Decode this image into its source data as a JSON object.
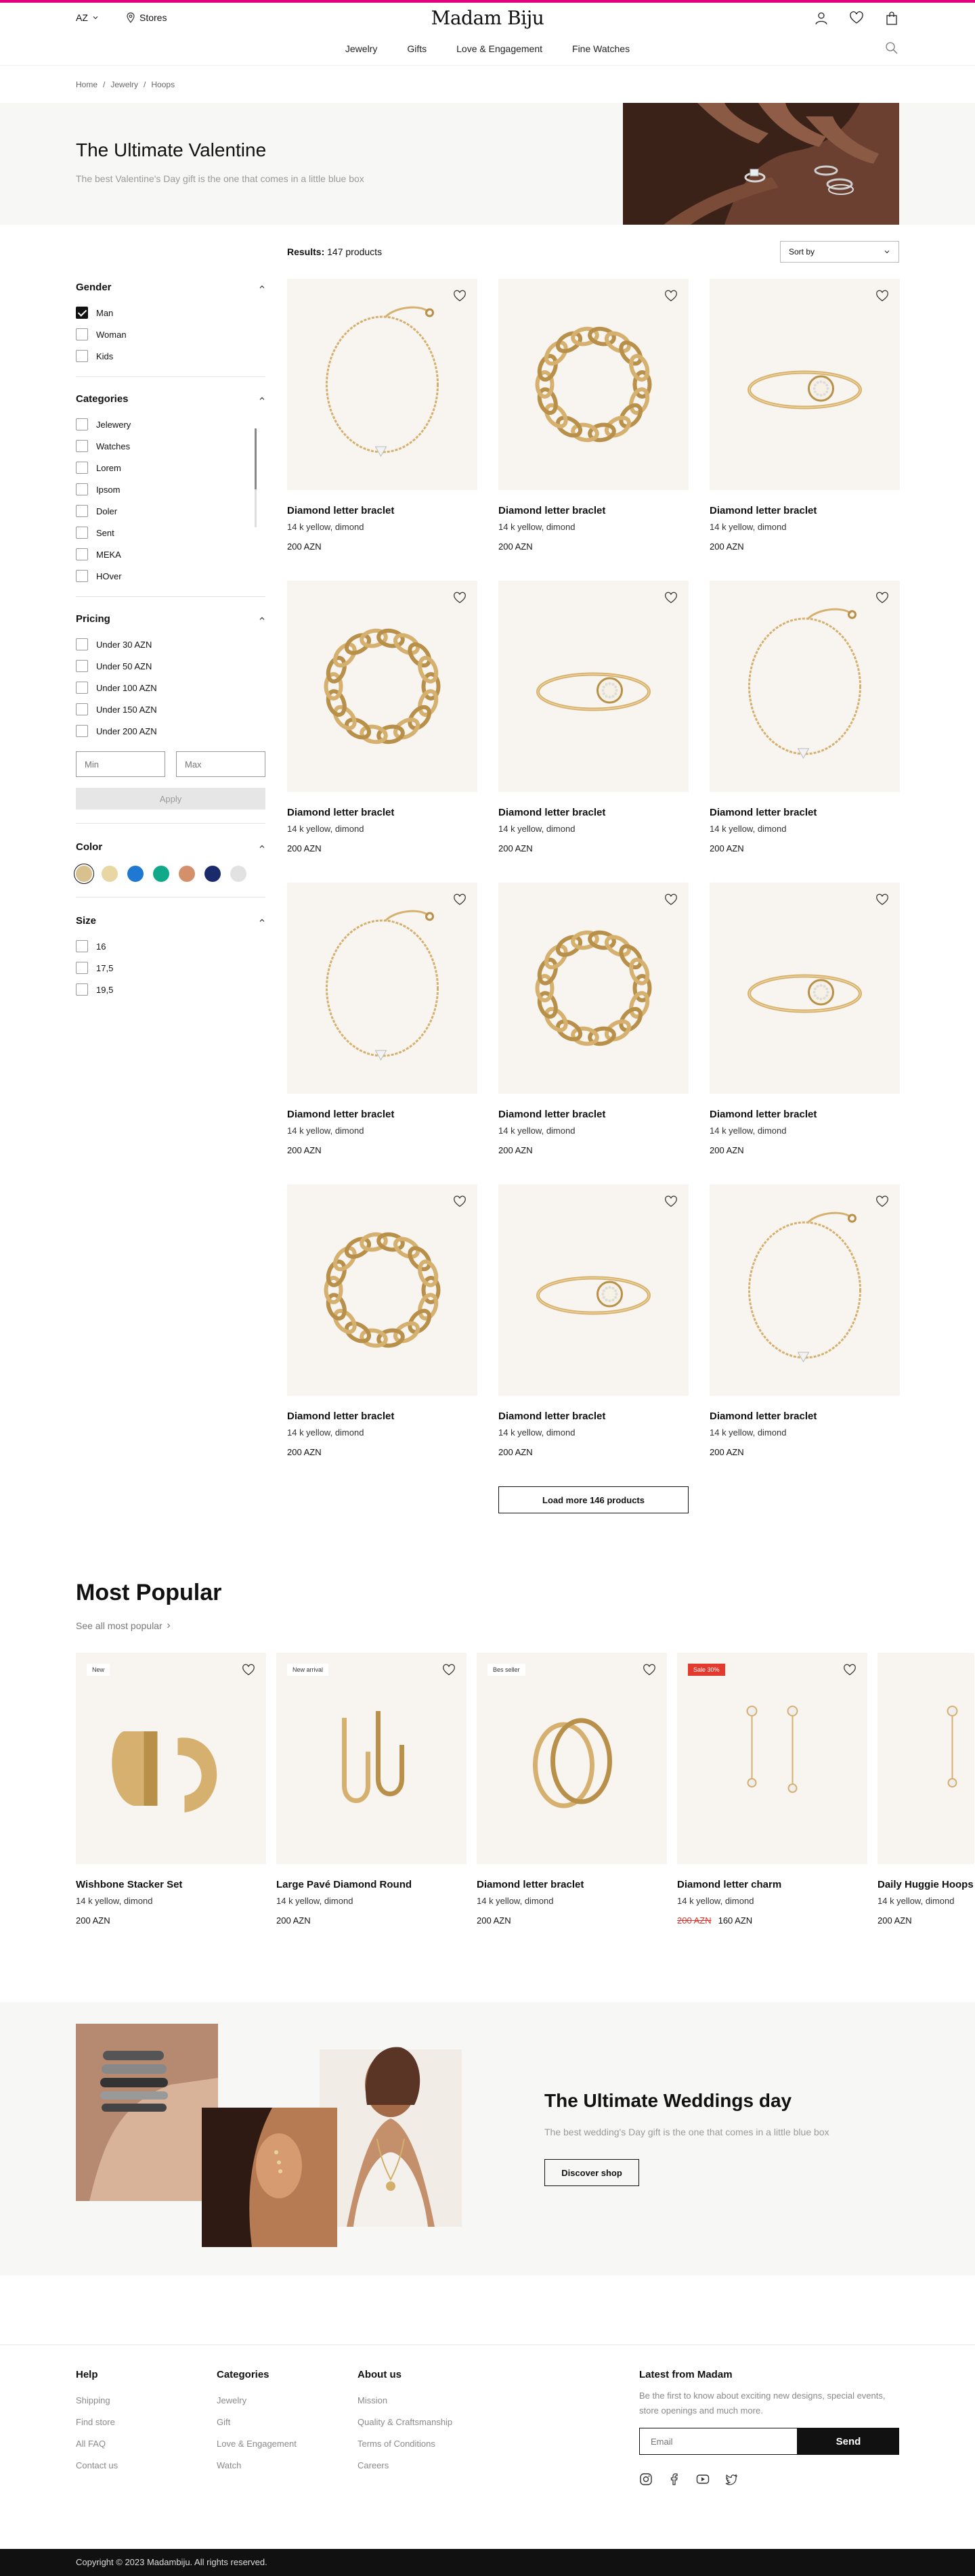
{
  "header": {
    "language": "AZ",
    "stores_label": "Stores",
    "logo": "Madam Biju",
    "nav": [
      "Jewelry",
      "Gifts",
      "Love & Engagement",
      "Fine Watches"
    ]
  },
  "breadcrumbs": [
    "Home",
    "/",
    "Jewelry",
    "/",
    "Hoops"
  ],
  "hero": {
    "title": "The Ultimate Valentine",
    "subtitle": "The best Valentine's Day gift is the one that comes in a little blue box"
  },
  "results": {
    "label": "Results:",
    "count": "147 products"
  },
  "sort": {
    "label": "Sort by"
  },
  "filters": {
    "gender": {
      "title": "Gender",
      "options": [
        "Man",
        "Woman",
        "Kids"
      ],
      "checked": [
        true,
        false,
        false
      ]
    },
    "categories": {
      "title": "Categories",
      "options": [
        "Jelewery",
        "Watches",
        "Lorem",
        "Ipsom",
        "Doler",
        "Sent",
        "MEKA",
        "HOver"
      ]
    },
    "pricing": {
      "title": "Pricing",
      "options": [
        "Under 30 AZN",
        "Under 50 AZN",
        "Under 100 AZN",
        "Under 150 AZN",
        "Under 200 AZN"
      ],
      "min_placeholder": "Min",
      "max_placeholder": "Max",
      "apply": "Apply"
    },
    "color": {
      "title": "Color",
      "swatches": [
        "#d9c08f",
        "#e8d6a3",
        "#1f78d1",
        "#12a88a",
        "#d4906a",
        "#1a2a6b",
        "#e2e2e2"
      ]
    },
    "size": {
      "title": "Size",
      "options": [
        "16",
        "17,5",
        "19,5"
      ]
    }
  },
  "products": [
    {
      "name": "Diamond letter braclet",
      "meta": "14 k yellow, dimond",
      "price": "200 AZN",
      "image": "chain-bracelet"
    },
    {
      "name": "Diamond letter braclet",
      "meta": "14 k yellow, dimond",
      "price": "200 AZN",
      "image": "curb-chain"
    },
    {
      "name": "Diamond letter braclet",
      "meta": "14 k yellow, dimond",
      "price": "200 AZN",
      "image": "pave-ring"
    },
    {
      "name": "Diamond letter braclet",
      "meta": "14 k yellow, dimond",
      "price": "200 AZN",
      "image": "curb-chain"
    },
    {
      "name": "Diamond letter braclet",
      "meta": "14 k yellow, dimond",
      "price": "200 AZN",
      "image": "pave-ring"
    },
    {
      "name": "Diamond letter braclet",
      "meta": "14 k yellow, dimond",
      "price": "200 AZN",
      "image": "chain-bracelet"
    },
    {
      "name": "Diamond letter braclet",
      "meta": "14 k yellow, dimond",
      "price": "200 AZN",
      "image": "chain-bracelet"
    },
    {
      "name": "Diamond letter braclet",
      "meta": "14 k yellow, dimond",
      "price": "200 AZN",
      "image": "curb-chain"
    },
    {
      "name": "Diamond letter braclet",
      "meta": "14 k yellow, dimond",
      "price": "200 AZN",
      "image": "pave-ring"
    },
    {
      "name": "Diamond letter braclet",
      "meta": "14 k yellow, dimond",
      "price": "200 AZN",
      "image": "curb-chain"
    },
    {
      "name": "Diamond letter braclet",
      "meta": "14 k yellow, dimond",
      "price": "200 AZN",
      "image": "pave-ring"
    },
    {
      "name": "Diamond letter braclet",
      "meta": "14 k yellow, dimond",
      "price": "200 AZN",
      "image": "chain-bracelet"
    }
  ],
  "load_more": "Load more 146 products",
  "popular": {
    "title": "Most Popular",
    "link": "See all most popular",
    "items": [
      {
        "badge": "New",
        "name": "Wishbone Stacker Set",
        "meta": "14 k yellow, dimond",
        "price": "200 AZN",
        "image": "wide-hoops"
      },
      {
        "badge": "New arrival",
        "name": "Large Pavé Diamond Round",
        "meta": "14 k yellow, dimond",
        "price": "200 AZN",
        "image": "j-hoops"
      },
      {
        "badge": "Bes seller",
        "name": "Diamond letter braclet",
        "meta": "14 k yellow, dimond",
        "price": "200 AZN",
        "image": "round-hoops"
      },
      {
        "badge": "Sale 30%",
        "name": "Diamond letter charm",
        "meta": "14 k yellow, dimond",
        "old_price": "200 AZN",
        "price": "160 AZN",
        "image": "drop-earrings"
      },
      {
        "badge": "",
        "name": "Daily Huggie Hoops",
        "meta": "14 k yellow, dimond",
        "price": "200 AZN",
        "image": "drop-earrings"
      }
    ]
  },
  "weddings": {
    "title": "The Ultimate Weddings day",
    "subtitle": "The best wedding's Day gift is the one that comes in a little blue box",
    "button": "Discover shop"
  },
  "footer": {
    "help": {
      "title": "Help",
      "links": [
        "Shipping",
        "Find store",
        "All FAQ",
        "Contact us"
      ]
    },
    "categories": {
      "title": "Categories",
      "links": [
        "Jewelry",
        "Gift",
        "Love & Engagement",
        "Watch"
      ]
    },
    "about": {
      "title": "About us",
      "links": [
        "Mission",
        "Quality & Craftsmanship",
        "Terms of Conditions",
        "Careers"
      ]
    },
    "newsletter": {
      "title": "Latest from Madam",
      "text": "Be the first to know about exciting new designs, special events, store openings and much more.",
      "placeholder": "Email",
      "button": "Send"
    },
    "social": [
      "instagram-icon",
      "facebook-icon",
      "youtube-icon",
      "twitter-icon"
    ],
    "copyright": "Copyright © 2023 Madambiju. All rights reserved."
  },
  "colors": {
    "accent": "#e3007f",
    "sale": "#e23a2e",
    "card_bg": "#f8f5f0"
  }
}
